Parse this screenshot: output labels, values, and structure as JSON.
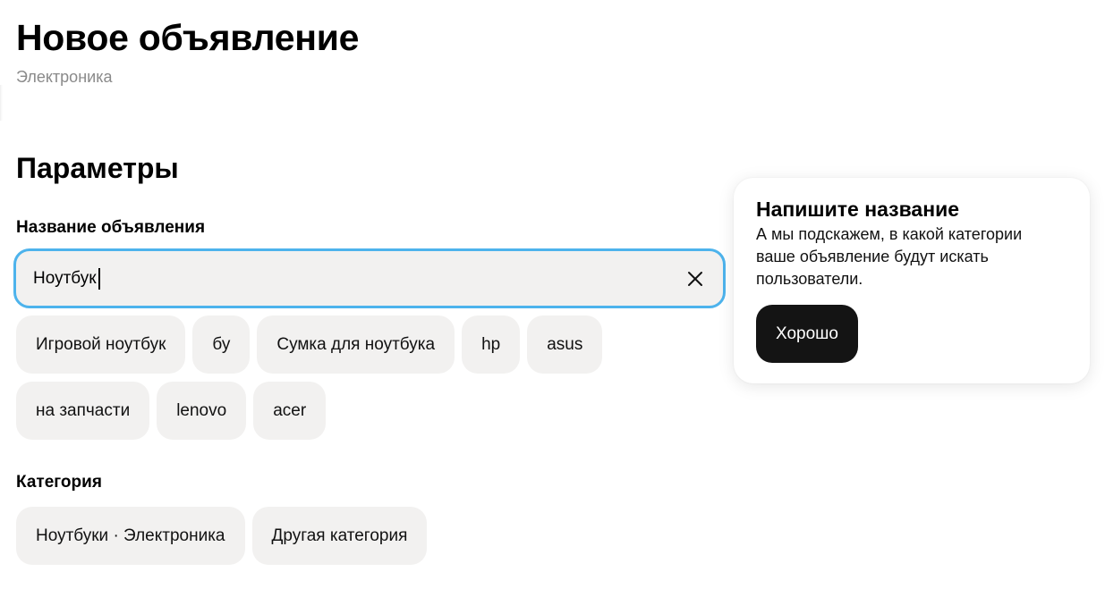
{
  "header": {
    "title": "Новое объявление",
    "subtitle": "Электроника"
  },
  "params": {
    "section_title": "Параметры",
    "title_field": {
      "label": "Название объявления",
      "value": "Ноутбук",
      "placeholder": ""
    },
    "suggestions_row1": [
      "Игровой ноутбук",
      "бу",
      "Сумка для ноутбука",
      "hp",
      "asus"
    ],
    "suggestions_row2": [
      "на запчасти",
      "lenovo",
      "acer"
    ],
    "category": {
      "label": "Категория",
      "options": [
        "Ноутбуки · Электроника",
        "Другая категория"
      ]
    }
  },
  "tooltip": {
    "title": "Напишите название",
    "text": "А мы подскажем, в какой категории ваше объявление будут искать пользователи.",
    "button_label": "Хорошо"
  },
  "icons": {
    "clear": "close-icon"
  },
  "colors": {
    "input_focus_border": "#4db3ec",
    "chip_bg": "#f2f1f0",
    "primary_button_bg": "#141414",
    "subtitle_text": "#8a8a8a"
  }
}
